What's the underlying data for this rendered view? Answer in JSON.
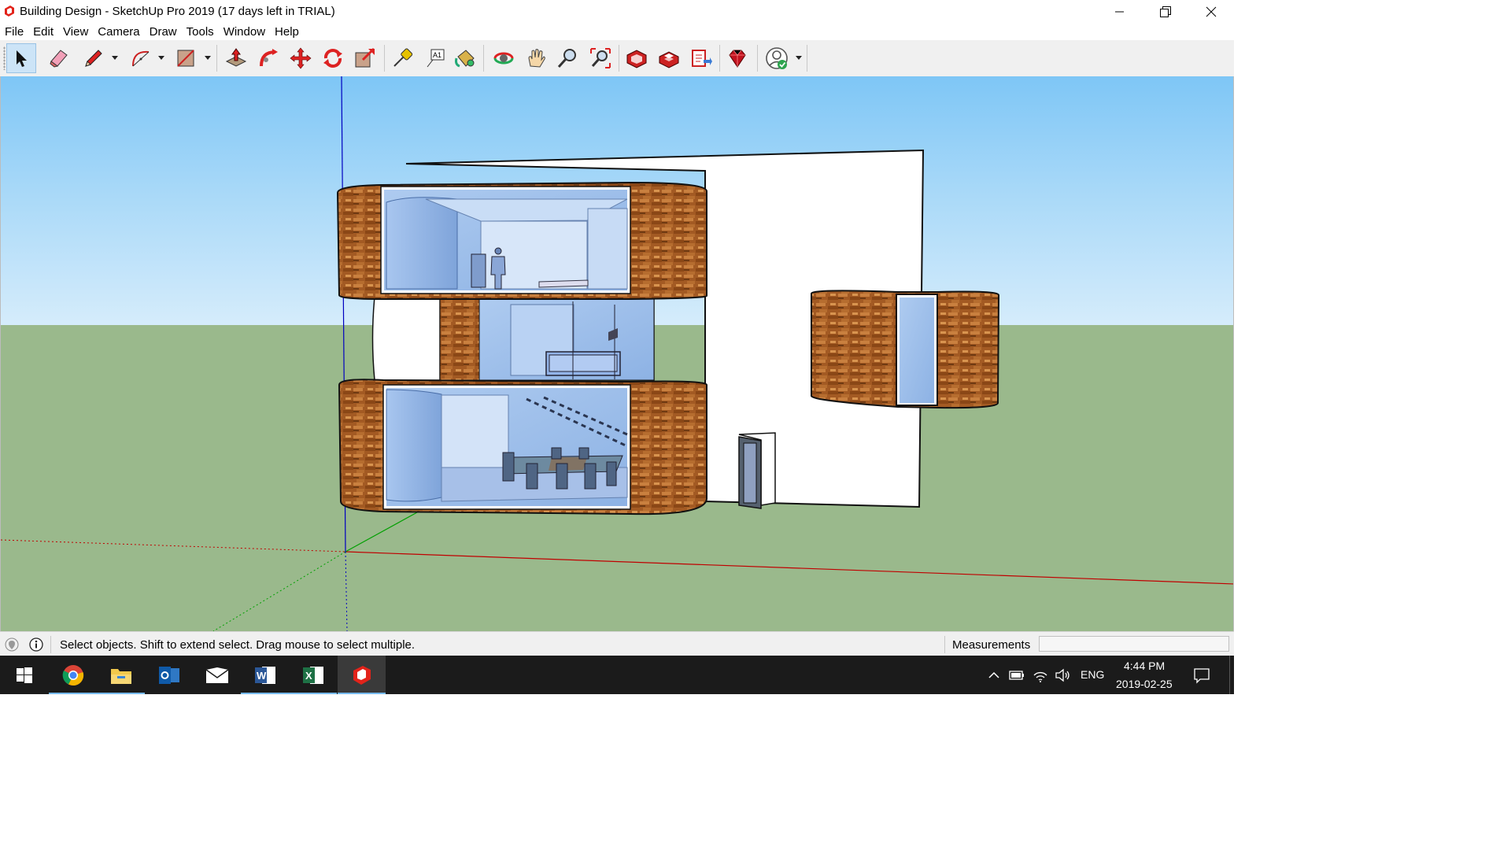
{
  "window": {
    "title": "Building Design - SketchUp Pro 2019 (17 days left in TRIAL)",
    "app_icon": "sketchup-icon",
    "controls": [
      "minimize-icon",
      "restore-icon",
      "close-icon"
    ]
  },
  "menu": {
    "items": [
      "File",
      "Edit",
      "View",
      "Camera",
      "Draw",
      "Tools",
      "Window",
      "Help"
    ]
  },
  "toolbar": {
    "tools": [
      {
        "icon": "select-arrow-icon",
        "active": true
      },
      {
        "icon": "eraser-icon"
      },
      {
        "icon": "pencil-line-icon",
        "dropdown": true
      },
      {
        "icon": "arc-icon",
        "dropdown": true
      },
      {
        "icon": "rectangle-icon",
        "dropdown": true
      },
      {
        "icon": "push-pull-icon"
      },
      {
        "icon": "follow-me-icon"
      },
      {
        "icon": "move-icon"
      },
      {
        "icon": "rotate-icon"
      },
      {
        "icon": "scale-icon"
      },
      {
        "icon": "tape-measure-icon"
      },
      {
        "icon": "text-label-icon"
      },
      {
        "icon": "paint-bucket-icon"
      },
      {
        "icon": "orbit-icon"
      },
      {
        "icon": "pan-hand-icon"
      },
      {
        "icon": "zoom-icon"
      },
      {
        "icon": "zoom-extents-icon"
      },
      {
        "icon": "3d-warehouse-icon"
      },
      {
        "icon": "extension-warehouse-icon"
      },
      {
        "icon": "layout-send-icon"
      },
      {
        "icon": "extension-manager-ruby-icon"
      },
      {
        "icon": "account-signed-in-icon",
        "dropdown": true
      }
    ]
  },
  "viewport": {
    "sky_color": "#8ccdf7",
    "ground_color": "#9ab98c",
    "axis_colors": {
      "red": "#c00000",
      "green": "#00a000",
      "blue": "#0000c0"
    }
  },
  "status": {
    "text": "Select objects. Shift to extend select. Drag mouse to select multiple.",
    "icons": [
      "geolocation-icon",
      "info-icon"
    ],
    "measurements_label": "Measurements",
    "measurements_value": ""
  },
  "taskbar": {
    "apps": [
      "windows-start-icon",
      "chrome-icon",
      "file-explorer-icon",
      "outlook-icon",
      "mail-icon",
      "word-icon",
      "excel-icon",
      "sketchup-icon"
    ],
    "tray_icons": [
      "chevron-up-icon",
      "battery-icon",
      "wifi-icon",
      "volume-icon"
    ],
    "language": "ENG",
    "time": "4:44 PM",
    "date": "2019-02-25",
    "notifications_icon": "action-center-icon"
  }
}
